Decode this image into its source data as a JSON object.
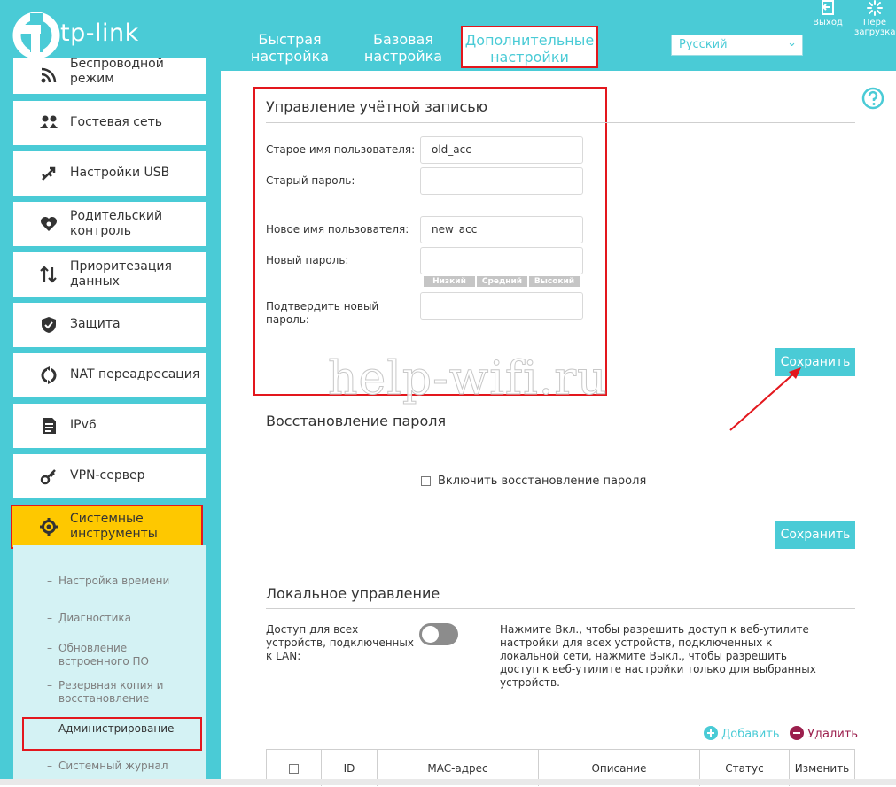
{
  "colors": {
    "brand": "#4acbd6",
    "highlight": "#fec800",
    "annotation_red": "#e3171d"
  },
  "header": {
    "logo_text": "tp-link",
    "tabs": [
      {
        "label": "Быстрая настройка"
      },
      {
        "label": "Базовая настройка"
      },
      {
        "label": "Дополнительные настройки"
      }
    ],
    "language": "Русский",
    "exit_label": "Выход",
    "reboot_label": "Пере загрузка"
  },
  "sidebar": {
    "items": [
      {
        "label": "Беспроводной режим",
        "icon": "wifi-icon"
      },
      {
        "label": "Гостевая сеть",
        "icon": "users-icon"
      },
      {
        "label": "Настройки USB",
        "icon": "usb-icon"
      },
      {
        "label": "Родительский контроль",
        "icon": "heart-icon"
      },
      {
        "label": "Приоритезация данных",
        "icon": "arrows-updown-icon"
      },
      {
        "label": "Защита",
        "icon": "shield-icon"
      },
      {
        "label": "NAT переадресация",
        "icon": "nat-icon"
      },
      {
        "label": "IPv6",
        "icon": "document-icon"
      },
      {
        "label": "VPN-сервер",
        "icon": "key-icon"
      },
      {
        "label": "Системные инструменты",
        "icon": "gear-icon"
      }
    ],
    "sub_items": [
      {
        "label": "Настройка времени"
      },
      {
        "label": "Диагностика"
      },
      {
        "label": "Обновление встроенного ПО"
      },
      {
        "label": "Резервная копия и восстановление"
      },
      {
        "label": "Администрирование"
      },
      {
        "label": "Системный журнал"
      }
    ]
  },
  "account": {
    "title": "Управление учётной записью",
    "old_user_label": "Старое имя пользователя:",
    "old_user_value": "old_acc",
    "old_pass_label": "Старый пароль:",
    "new_user_label": "Новое имя пользователя:",
    "new_user_value": "new_acc",
    "new_pass_label": "Новый пароль:",
    "strength": [
      "Низкий",
      "Средний",
      "Высокий"
    ],
    "confirm_label": "Подтвердить новый пароль:",
    "save_label": "Сохранить"
  },
  "recovery": {
    "title": "Восстановление пароля",
    "checkbox_label": "Включить восстановление пароля",
    "save_label": "Сохранить"
  },
  "local": {
    "title": "Локальное управление",
    "access_label": "Доступ для всех устройств, подключенных к LAN:",
    "description": "Нажмите Вкл., чтобы разрешить доступ к веб-утилите настройки для всех устройств, подключенных к локальной сети, нажмите Выкл., чтобы разрешить доступ к веб-утилите настройки только для выбранных устройств.",
    "add_label": "Добавить",
    "delete_label": "Удалить",
    "columns": [
      "ID",
      "MAC-адрес",
      "Описание",
      "Статус",
      "Изменить"
    ]
  },
  "watermark": "help-wifi.ru"
}
